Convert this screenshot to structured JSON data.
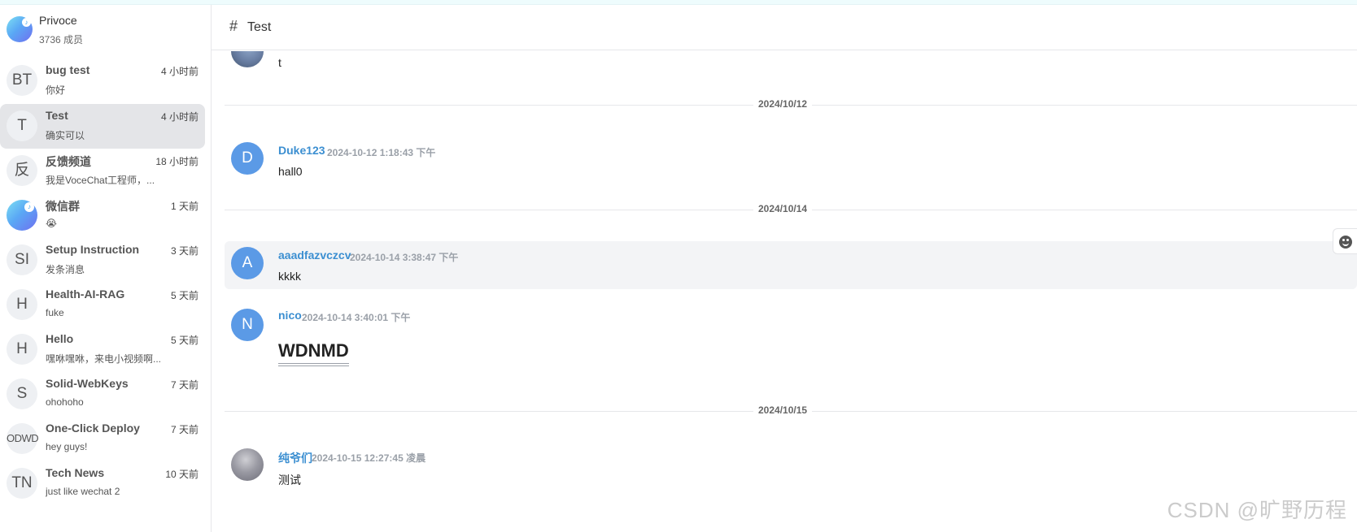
{
  "server": {
    "name": "Privoce",
    "members": "3736 成员"
  },
  "channels": [
    {
      "initials": "BT",
      "title": "bug test",
      "time": "4 小时前",
      "preview": "你好"
    },
    {
      "initials": "T",
      "title": "Test",
      "time": "4 小时前",
      "preview": "确实可以"
    },
    {
      "initials": "反",
      "title": "反馈频道",
      "time": "18 小时前",
      "preview": "我是VoceChat工程师，..."
    },
    {
      "initials": "",
      "title": "微信群",
      "time": "1 天前",
      "preview": "😭"
    },
    {
      "initials": "SI",
      "title": "Setup Instruction",
      "time": "3 天前",
      "preview": "发条消息"
    },
    {
      "initials": "H",
      "title": "Health-AI-RAG",
      "time": "5 天前",
      "preview": "fuke"
    },
    {
      "initials": "H",
      "title": "Hello",
      "time": "5 天前",
      "preview": "嘿咻嘿咻，来电小视频啊..."
    },
    {
      "initials": "S",
      "title": "Solid-WebKeys",
      "time": "7 天前",
      "preview": "ohohoho"
    },
    {
      "initials": "ODWD",
      "title": "One-Click Deploy",
      "time": "7 天前",
      "preview": "hey guys!"
    },
    {
      "initials": "TN",
      "title": "Tech News",
      "time": "10 天前",
      "preview": "just like wechat 2"
    }
  ],
  "header": {
    "hash": "#",
    "title": "Test"
  },
  "messages": [
    {
      "text": "t"
    },
    {
      "avatar": "D",
      "author": "Duke123",
      "time": "2024-10-12 1:18:43 下午",
      "text": "hall0"
    },
    {
      "avatar": "A",
      "author": "aaadfazvczcv",
      "time": "2024-10-14 3:38:47 下午",
      "text": "kkkk"
    },
    {
      "avatar": "N",
      "author": "nico",
      "time": "2024-10-14 3:40:01 下午",
      "text": "WDNMD"
    },
    {
      "author": "纯爷们",
      "time": "2024-10-15 12:27:45 凌晨",
      "text": "测试"
    }
  ],
  "dividers": [
    "2024/10/12",
    "2024/10/14",
    "2024/10/15"
  ],
  "watermark": "CSDN @旷野历程"
}
